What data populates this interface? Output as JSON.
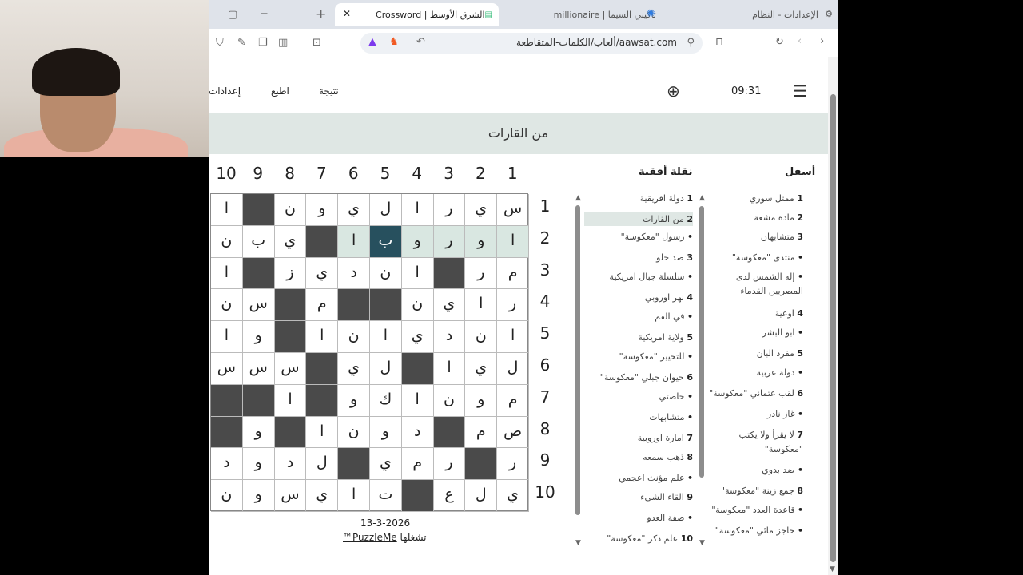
{
  "tabs": [
    {
      "label": "الإعدادات - النظام"
    },
    {
      "label": "تاكيني السيما | millionaire"
    },
    {
      "label": "الشرق الأوسط | Crossword"
    }
  ],
  "address": {
    "url": "aawsat.com/ألعاب/الكلمات-المتقاطعة"
  },
  "header": {
    "time": "09:31",
    "score": "نتيجة",
    "print": "اطبع",
    "settings": "إعدادات"
  },
  "current_clue": "من القارات",
  "grid": {
    "col_numbers": [
      "10",
      "9",
      "8",
      "7",
      "6",
      "5",
      "4",
      "3",
      "2",
      "1"
    ],
    "row_numbers": [
      "1",
      "2",
      "3",
      "4",
      "5",
      "6",
      "7",
      "8",
      "9",
      "10"
    ],
    "rows": [
      [
        "ا",
        "#",
        "ن",
        "و",
        "ي",
        "ل",
        "ا",
        "ر",
        "ي",
        "س"
      ],
      [
        "ن",
        "ب",
        "ي",
        "#",
        "ا",
        "ب",
        "و",
        "ر",
        "و",
        "ا"
      ],
      [
        "ا",
        "#",
        "ز",
        "ي",
        "د",
        "ن",
        "ا",
        "#",
        "ر",
        "م"
      ],
      [
        "ن",
        "س",
        "#",
        "م",
        "#",
        "#",
        "ن",
        "ي",
        "ا",
        "ر"
      ],
      [
        "ا",
        "و",
        "#",
        "ا",
        "ن",
        "ا",
        "ي",
        "د",
        "ن",
        "ا"
      ],
      [
        "س",
        "س",
        "س",
        "#",
        "ي",
        "ل",
        "#",
        "ا",
        "ي",
        "ل"
      ],
      [
        "#",
        "#",
        "ا",
        "#",
        "و",
        "ك",
        "ا",
        "ن",
        "و",
        "م"
      ],
      [
        "#",
        "و",
        "#",
        "ا",
        "ن",
        "و",
        "د",
        "#",
        "م",
        "ص"
      ],
      [
        "د",
        "و",
        "د",
        "ل",
        "#",
        "ي",
        "م",
        "ر",
        "#",
        "ر"
      ],
      [
        "ن",
        "و",
        "س",
        "ي",
        "ا",
        "ت",
        "#",
        "ع",
        "ل",
        "ي"
      ]
    ]
  },
  "date": "13-3-2026",
  "credit": {
    "brand": "PuzzleMe™",
    "text": "تشغلها"
  },
  "across": {
    "title": "نقلة أفقية",
    "items": [
      {
        "num": "1",
        "text": "دولة افريقية"
      },
      {
        "num": "2",
        "text": "من القارات"
      },
      {
        "num": "•",
        "text": "رسول \"معكوسة\""
      },
      {
        "num": "3",
        "text": "ضد حلو"
      },
      {
        "num": "•",
        "text": "سلسلة جبال امريكية"
      },
      {
        "num": "4",
        "text": "نهر اوروبي"
      },
      {
        "num": "•",
        "text": "في الفم"
      },
      {
        "num": "5",
        "text": "ولاية امريكية"
      },
      {
        "num": "•",
        "text": "للتخيير \"معكوسة\""
      },
      {
        "num": "6",
        "text": "حيوان جبلي \"معكوسة\""
      },
      {
        "num": "•",
        "text": "خاصتي"
      },
      {
        "num": "•",
        "text": "متشابهات"
      },
      {
        "num": "7",
        "text": "امارة اوروبية"
      },
      {
        "num": "8",
        "text": "ذهب سمعه"
      },
      {
        "num": "•",
        "text": "علم مؤنث اعجمي"
      },
      {
        "num": "9",
        "text": "القاء الشيء"
      },
      {
        "num": "•",
        "text": "صفة العدو"
      },
      {
        "num": "10",
        "text": "علم ذكر \"معكوسة\""
      }
    ]
  },
  "down": {
    "title": "أسفل",
    "items": [
      {
        "num": "1",
        "text": "ممثل سوري"
      },
      {
        "num": "2",
        "text": "مادة مشعة"
      },
      {
        "num": "3",
        "text": "متشابهان"
      },
      {
        "num": "•",
        "text": "منتدى \"معكوسة\""
      },
      {
        "num": "•",
        "text": "إله الشمس لدى"
      },
      {
        "num": "",
        "text": "المصريين القدماء"
      },
      {
        "num": "4",
        "text": "اوعية"
      },
      {
        "num": "•",
        "text": "ابو البشر"
      },
      {
        "num": "5",
        "text": "مفرد البان"
      },
      {
        "num": "•",
        "text": "دولة عربية"
      },
      {
        "num": "6",
        "text": "لقب عثماني \"معكوسة\""
      },
      {
        "num": "•",
        "text": "غاز نادر"
      },
      {
        "num": "7",
        "text": "لا يقرأ ولا يكتب"
      },
      {
        "num": "",
        "text": "\"معكوسة\""
      },
      {
        "num": "•",
        "text": "ضد بدوي"
      },
      {
        "num": "8",
        "text": "جمع زينة \"معكوسة\""
      },
      {
        "num": "•",
        "text": "قاعدة العدد \"معكوسة\""
      },
      {
        "num": "•",
        "text": "حاجز مائي \"معكوسة\""
      }
    ]
  }
}
